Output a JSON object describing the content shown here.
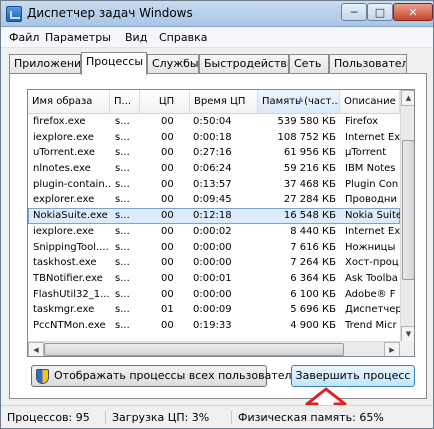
{
  "window": {
    "title": "Диспетчер задач Windows",
    "min_label": "─",
    "max_label": "□",
    "close_label": "✕"
  },
  "menu": [
    "Файл",
    "Параметры",
    "Вид",
    "Справка"
  ],
  "tabs": [
    "Приложения",
    "Процессы",
    "Службы",
    "Быстродействие",
    "Сеть",
    "Пользователи"
  ],
  "active_tab": "Процессы",
  "columns": {
    "name": "Имя образа",
    "user": "П...",
    "cpu": "ЦП",
    "time": "Время ЦП",
    "mem": "Память (част...",
    "desc": "Описание"
  },
  "processes": [
    {
      "name": "firefox.exe",
      "user": "s...",
      "cpu": "00",
      "time": "0:50:04",
      "mem": "539 580 КБ",
      "desc": "Firefox"
    },
    {
      "name": "iexplore.exe",
      "user": "s...",
      "cpu": "00",
      "time": "0:00:18",
      "mem": "108 752 КБ",
      "desc": "Internet Ex"
    },
    {
      "name": "uTorrent.exe",
      "user": "s...",
      "cpu": "00",
      "time": "0:27:16",
      "mem": "61 956 КБ",
      "desc": "µTorrent"
    },
    {
      "name": "nlnotes.exe",
      "user": "s...",
      "cpu": "00",
      "time": "0:06:24",
      "mem": "59 216 КБ",
      "desc": "IBM Notes"
    },
    {
      "name": "plugin-contain...",
      "user": "s...",
      "cpu": "00",
      "time": "0:13:57",
      "mem": "37 468 КБ",
      "desc": "Plugin Con"
    },
    {
      "name": "explorer.exe",
      "user": "s...",
      "cpu": "00",
      "time": "0:09:45",
      "mem": "27 284 КБ",
      "desc": "Проводни"
    },
    {
      "name": "NokiaSuite.exe",
      "user": "s...",
      "cpu": "00",
      "time": "0:12:18",
      "mem": "16 548 КБ",
      "desc": "Nokia Suite"
    },
    {
      "name": "iexplore.exe",
      "user": "s...",
      "cpu": "00",
      "time": "0:00:02",
      "mem": "8 440 КБ",
      "desc": "Internet Ex"
    },
    {
      "name": "SnippingTool....",
      "user": "s...",
      "cpu": "00",
      "time": "0:00:00",
      "mem": "7 616 КБ",
      "desc": "Ножницы"
    },
    {
      "name": "taskhost.exe",
      "user": "s...",
      "cpu": "00",
      "time": "0:00:00",
      "mem": "7 264 КБ",
      "desc": "Хост-проц"
    },
    {
      "name": "TBNotifier.exe",
      "user": "s...",
      "cpu": "00",
      "time": "0:00:01",
      "mem": "6 364 КБ",
      "desc": "Ask Toolba"
    },
    {
      "name": "FlashUtil32_1...",
      "user": "s...",
      "cpu": "00",
      "time": "0:00:00",
      "mem": "6 100 КБ",
      "desc": "Adobe® F"
    },
    {
      "name": "taskmgr.exe",
      "user": "s...",
      "cpu": "01",
      "time": "0:00:09",
      "mem": "5 696 КБ",
      "desc": "Диспетчер"
    },
    {
      "name": "PccNTMon.exe",
      "user": "s...",
      "cpu": "00",
      "time": "0:19:33",
      "mem": "4 900 КБ",
      "desc": "Trend Micr"
    }
  ],
  "selected_index": 6,
  "buttons": {
    "show_all": "Отображать процессы всех пользователей",
    "end_process": "Завершить процесс"
  },
  "status": {
    "processes": "Процессов: 95",
    "cpu": "Загрузка ЦП: 3%",
    "memory": "Физическая память: 65%"
  },
  "colors": {
    "selection": "#dcecfc",
    "highlight_arrow": "#e02020"
  },
  "icons": {
    "app": "taskmanager-icon",
    "shield": "uac-shield-icon",
    "annotation": "red-up-arrow-icon"
  }
}
